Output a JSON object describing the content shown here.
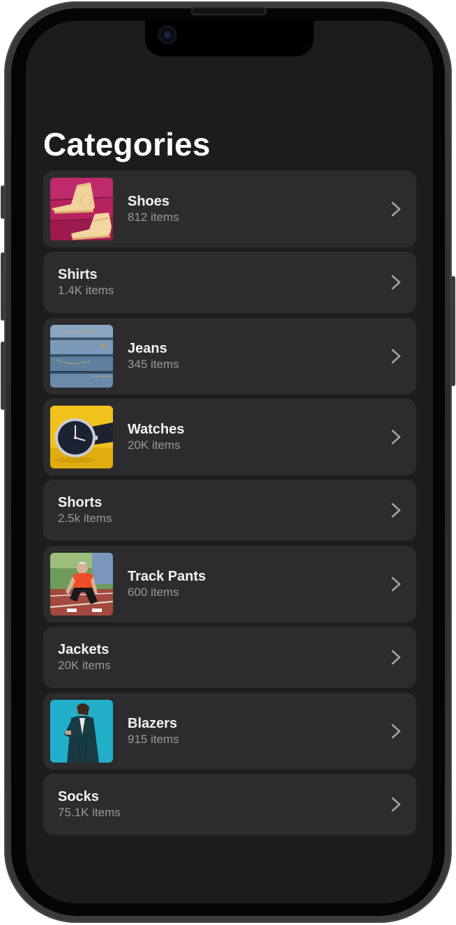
{
  "header": {
    "title": "Categories"
  },
  "categories": [
    {
      "name": "Shoes",
      "count": "812 items",
      "thumbnail": "pink-sneakers-photo"
    },
    {
      "name": "Shirts",
      "count": "1.4K items"
    },
    {
      "name": "Jeans",
      "count": "345 items",
      "thumbnail": "folded-denim-photo"
    },
    {
      "name": "Watches",
      "count": "20K items",
      "thumbnail": "wristwatch-on-yellow-photo"
    },
    {
      "name": "Shorts",
      "count": "2.5k items"
    },
    {
      "name": "Track Pants",
      "count": "600 items",
      "thumbnail": "sprinter-on-track-photo"
    },
    {
      "name": "Jackets",
      "count": "20K items"
    },
    {
      "name": "Blazers",
      "count": "915 items",
      "thumbnail": "person-in-blazer-photo"
    },
    {
      "name": "Socks",
      "count": "75.1K items"
    }
  ],
  "colors": {
    "background": "#1c1c1e",
    "row": "#2c2c2e",
    "title": "#ffffff",
    "subtitle": "#98989f",
    "chevron": "#a1a1a6"
  },
  "icons": {
    "row_chevron": "chevron-right-icon"
  }
}
